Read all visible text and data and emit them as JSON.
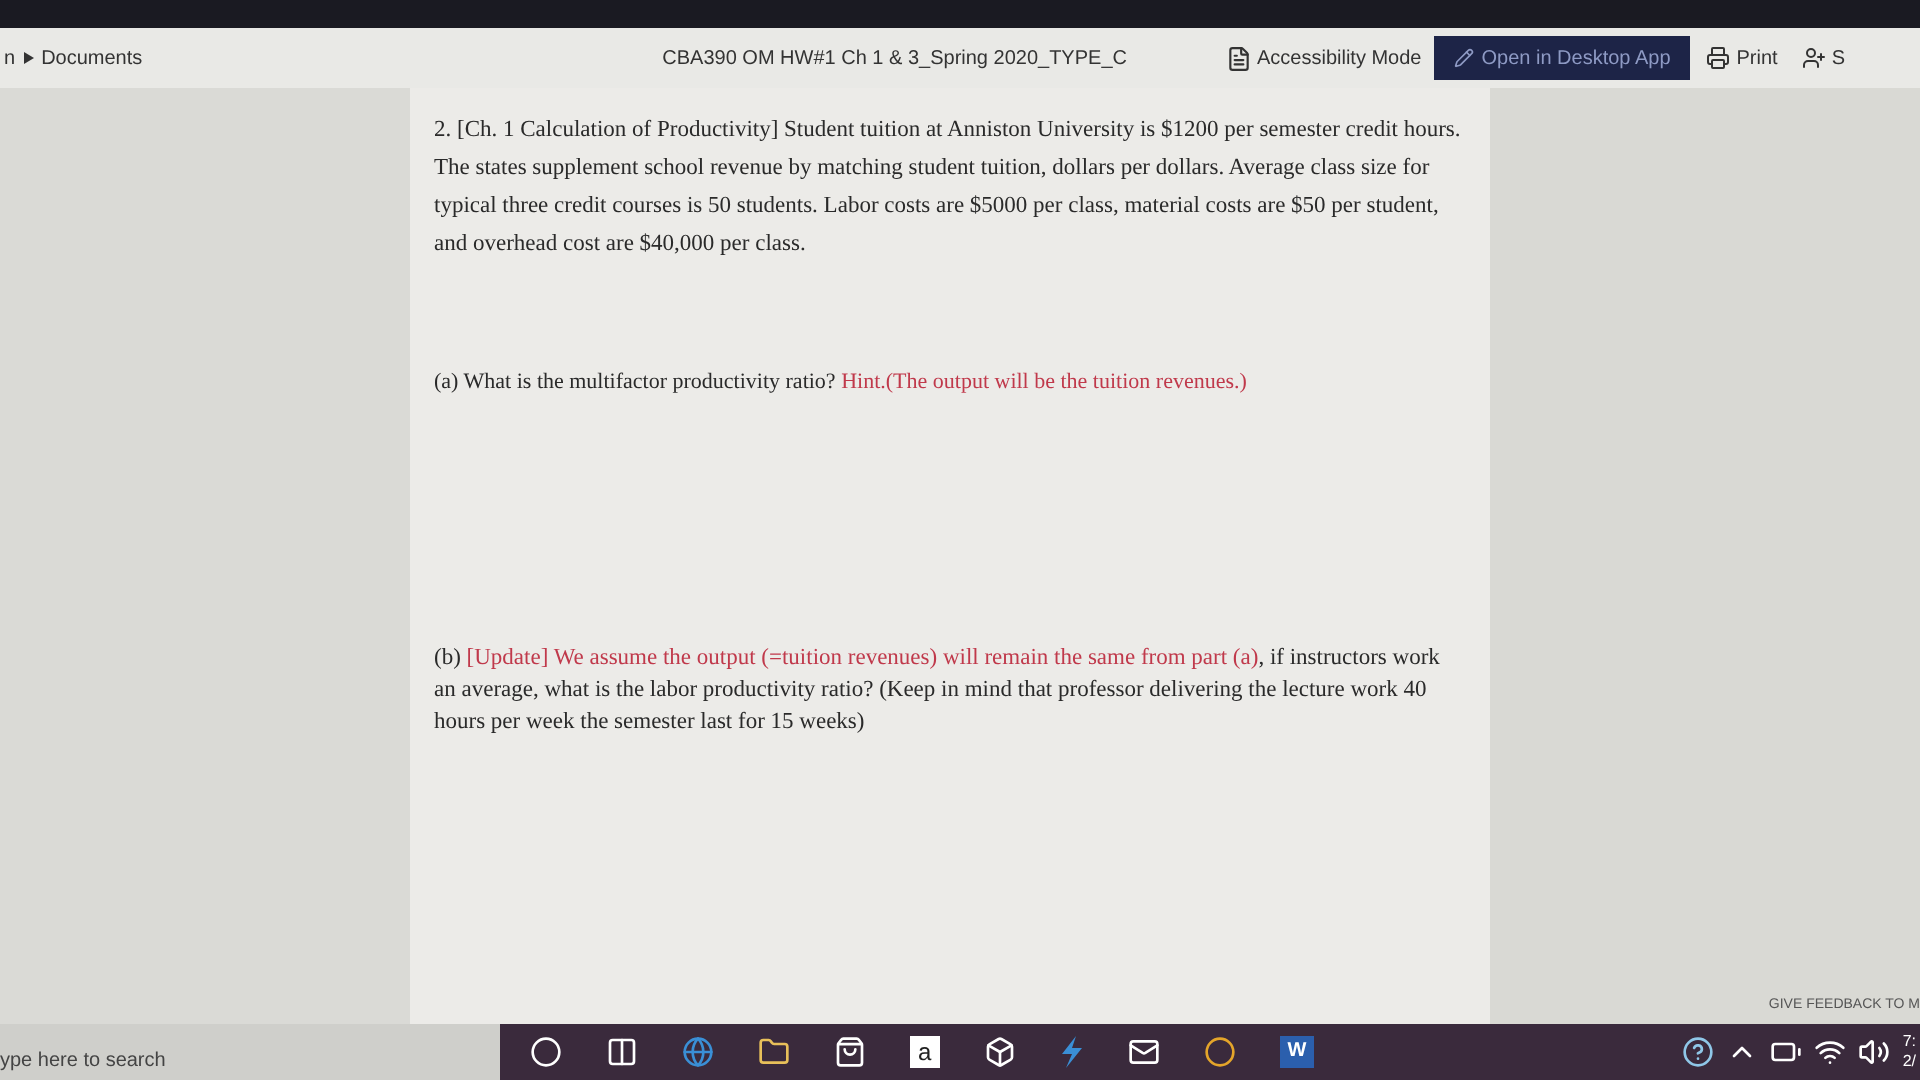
{
  "toolbar": {
    "breadcrumb_start": "n",
    "breadcrumb": "Documents",
    "title": "CBA390 OM HW#1 Ch 1 & 3_Spring 2020_TYPE_C",
    "accessibility": "Accessibility Mode",
    "open_desktop": "Open in Desktop App",
    "print": "Print",
    "share": "S"
  },
  "document": {
    "intro": "2. [Ch. 1 Calculation of Productivity] Student tuition at Anniston University is $1200 per semester credit hours. The states supplement school revenue by matching student tuition, dollars per dollars. Average class size for typical three credit courses is 50 students. Labor costs are $5000 per class, material costs are $50 per student, and overhead cost are $40,000 per class.",
    "part_a": {
      "label": "(a)",
      "question": "What is the multifactor productivity ratio?",
      "hint": "Hint.(The output will be the tuition revenues.)"
    },
    "part_b": {
      "label": "(b)",
      "note": "[Update] We assume the output (=tuition revenues) will remain the same from part (a)",
      "question": ", if instructors work an average, what is the labor productivity ratio? (Keep in mind that professor delivering the lecture work 40 hours per week the semester last for 15 weeks)"
    }
  },
  "feedback": "GIVE FEEDBACK TO M",
  "taskbar": {
    "search_placeholder": "ype here to search",
    "amazon": "a",
    "word": "W",
    "time": "7:",
    "date": "2/"
  }
}
